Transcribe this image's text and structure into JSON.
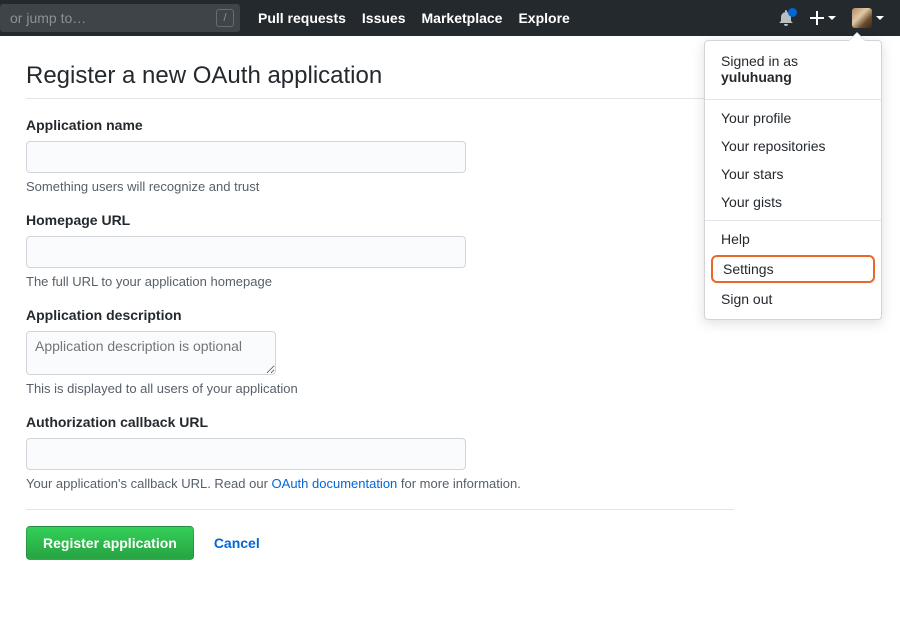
{
  "header": {
    "search_placeholder": "or jump to…",
    "slash_key": "/",
    "nav": [
      "Pull requests",
      "Issues",
      "Marketplace",
      "Explore"
    ]
  },
  "dropdown": {
    "signed_in_label": "Signed in as",
    "username": "yuluhuang",
    "group1": [
      "Your profile",
      "Your repositories",
      "Your stars",
      "Your gists"
    ],
    "group2": [
      "Help",
      "Settings",
      "Sign out"
    ],
    "highlighted": "Settings"
  },
  "page": {
    "title": "Register a new OAuth application",
    "fields": {
      "app_name": {
        "label": "Application name",
        "hint": "Something users will recognize and trust"
      },
      "homepage": {
        "label": "Homepage URL",
        "hint": "The full URL to your application homepage"
      },
      "description": {
        "label": "Application description",
        "placeholder": "Application description is optional",
        "hint": "This is displayed to all users of your application"
      },
      "callback": {
        "label": "Authorization callback URL",
        "hint_pre": "Your application's callback URL. Read our ",
        "hint_link": "OAuth documentation",
        "hint_post": " for more information."
      }
    },
    "actions": {
      "submit": "Register application",
      "cancel": "Cancel"
    }
  }
}
